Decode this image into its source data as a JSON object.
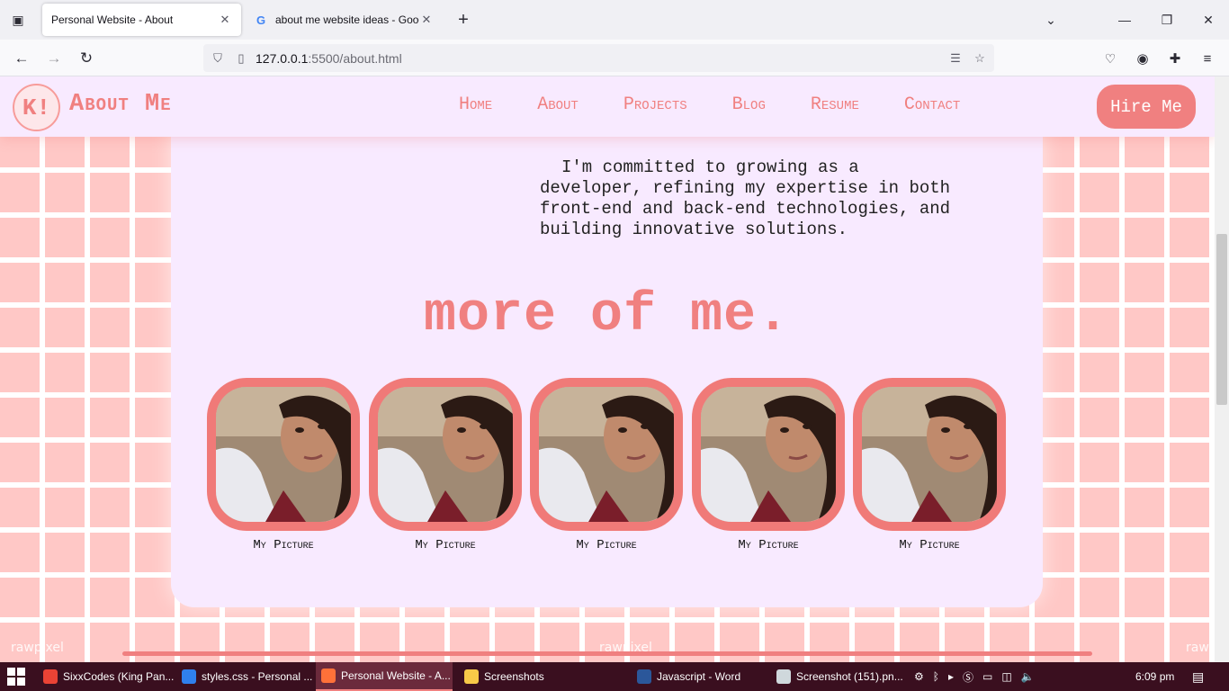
{
  "browser": {
    "tabs": [
      {
        "title": "Personal Website - About",
        "active": true
      },
      {
        "title": "about me website ideas - Googl",
        "active": false,
        "favicon": "G"
      }
    ],
    "url_host": "127.0.0.1",
    "url_rest": ":5500/about.html"
  },
  "site": {
    "logo_text": "K!",
    "title": "About Me",
    "nav": [
      "Home",
      "About",
      "Projects",
      "Blog",
      "Resume",
      "Contact"
    ],
    "hire_label": "Hire Me",
    "accent_color": "#f08080"
  },
  "main": {
    "intro_text": "I'm committed to growing as a developer, refining my expertise in both front-end and back-end technologies, and building innovative solutions.",
    "section_title": "more of me.",
    "pictures": [
      {
        "caption": "My Picture"
      },
      {
        "caption": "My Picture"
      },
      {
        "caption": "My Picture"
      },
      {
        "caption": "My Picture"
      },
      {
        "caption": "My Picture"
      }
    ],
    "watermarks": [
      "rawpixel",
      "rawpixel",
      "rawp"
    ]
  },
  "taskbar": {
    "items": [
      {
        "label": "SixxCodes (King Pan...",
        "icon_color": "#ea4335"
      },
      {
        "label": "styles.css - Personal ...",
        "icon_color": "#2f80ed"
      },
      {
        "label": "Personal Website - A...",
        "icon_color": "#ff7139",
        "active": true
      },
      {
        "label": "Screenshots",
        "icon_color": "#f7c948"
      },
      {
        "label": "Javascript - Word",
        "icon_color": "#2b579a"
      },
      {
        "label": "Screenshot (151).pn...",
        "icon_color": "#cfd8dc"
      }
    ],
    "time": "6:09 pm"
  }
}
